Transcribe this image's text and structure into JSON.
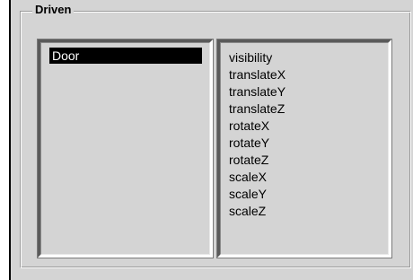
{
  "group": {
    "title": "Driven"
  },
  "objects_list": {
    "items": [
      "Door"
    ],
    "selected": "Door"
  },
  "attributes_list": {
    "items": [
      "visibility",
      "translateX",
      "translateY",
      "translateZ",
      "rotateX",
      "rotateY",
      "rotateZ",
      "scaleX",
      "scaleY",
      "scaleZ"
    ]
  },
  "colors": {
    "panel_bg": "#d4d4d4",
    "selection_bg": "#000000",
    "selection_fg": "#ffffff"
  }
}
